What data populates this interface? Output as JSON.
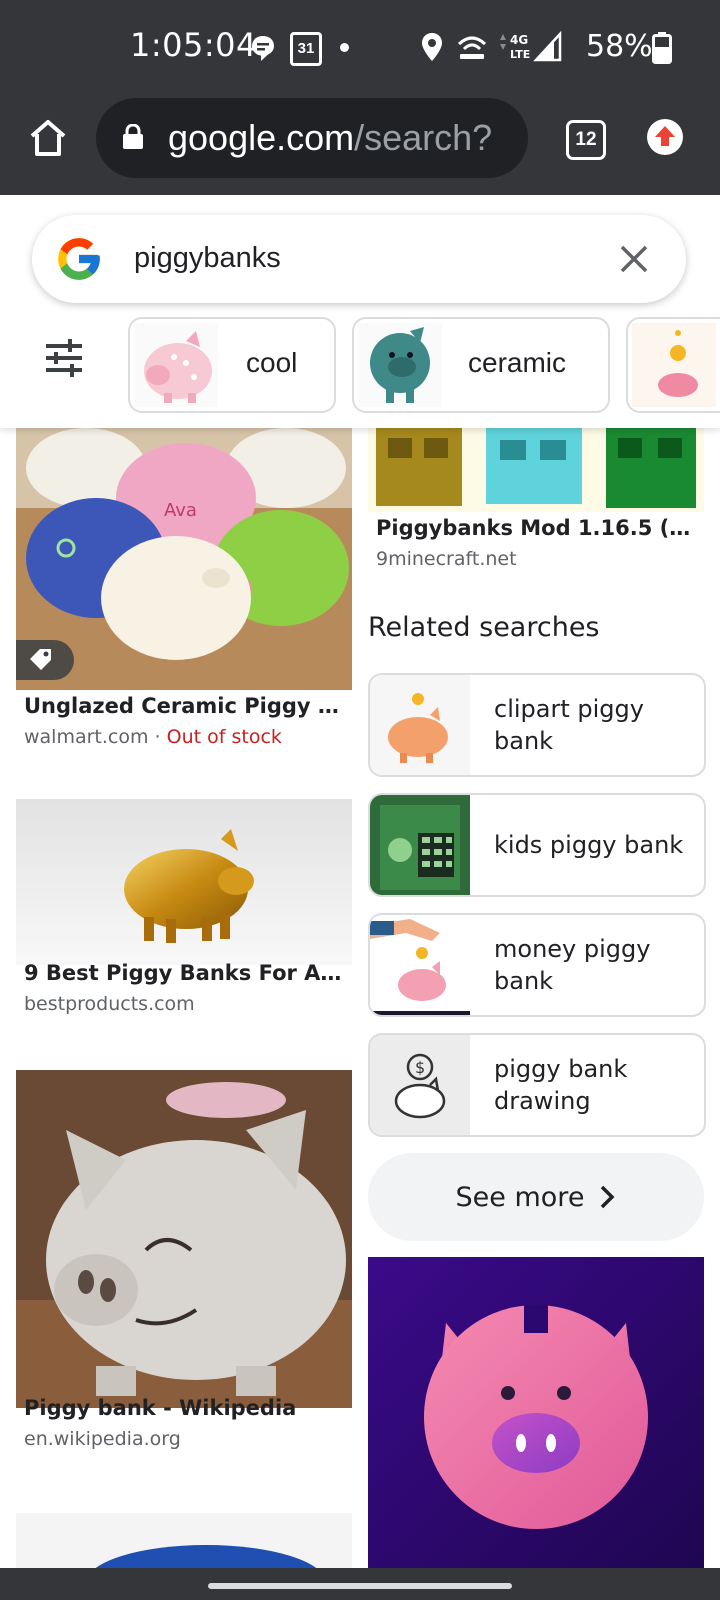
{
  "status_bar": {
    "time": "1:05:04",
    "calendar_date": "31",
    "network": "4G LTE",
    "battery": "58%"
  },
  "browser": {
    "url_host": "google.com",
    "url_path": "/search?",
    "tab_count": "12"
  },
  "search": {
    "query": "piggybanks",
    "chips": [
      {
        "label": "cool"
      },
      {
        "label": "ceramic"
      }
    ]
  },
  "results": {
    "left": [
      {
        "title": "Unglazed Ceramic Piggy Ban…",
        "source": "walmart.com",
        "separator": " · ",
        "stock": "Out of stock"
      },
      {
        "title": "9 Best Piggy Banks For Adult…",
        "source": "bestproducts.com"
      },
      {
        "title": "Piggy bank - Wikipedia",
        "source": "en.wikipedia.org"
      }
    ],
    "right": [
      {
        "title": "Piggybanks Mod 1.16.5 (Ban…",
        "source": "9minecraft.net"
      }
    ]
  },
  "related": {
    "heading": "Related searches",
    "items": [
      {
        "label": "clipart piggy bank"
      },
      {
        "label": "kids piggy bank"
      },
      {
        "label": "money piggy bank"
      },
      {
        "label": "piggy bank drawing"
      }
    ],
    "see_more": "See more"
  },
  "colors": {
    "chrome": "#35363a",
    "url_bar": "#202124",
    "out_of_stock": "#c5221f",
    "upload_badge": "#ea4335"
  },
  "icons": [
    "home-icon",
    "lock-icon",
    "tab-switcher-icon",
    "upload-icon",
    "google-logo",
    "clear-icon",
    "filter-icon",
    "tag-icon",
    "chevron-right-icon"
  ]
}
